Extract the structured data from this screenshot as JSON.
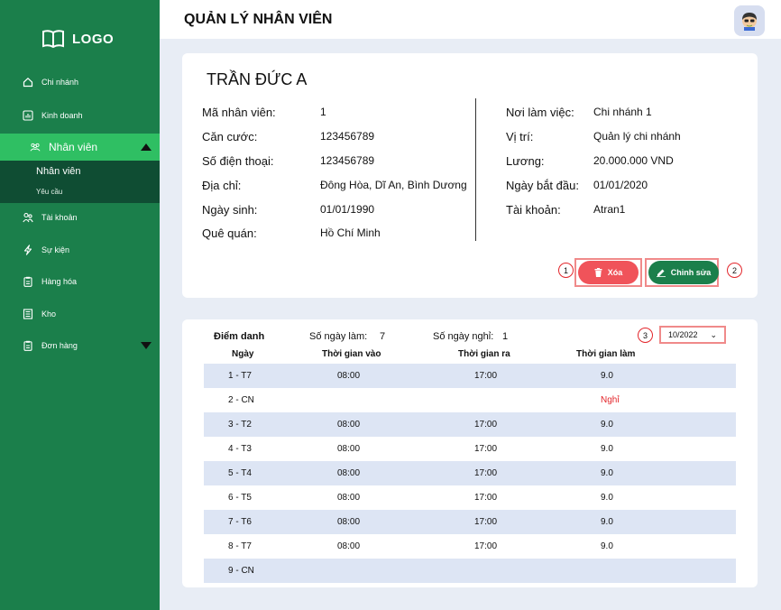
{
  "sidebar": {
    "logo": "LOGO",
    "items": [
      {
        "label": "Chi nhánh",
        "icon": "home-icon"
      },
      {
        "label": "Kinh doanh",
        "icon": "chart-icon"
      },
      {
        "label": "Nhân viên",
        "icon": "users-icon"
      },
      {
        "label": "Tài khoản",
        "icon": "account-icon"
      },
      {
        "label": "Sự kiện",
        "icon": "lightning-icon"
      },
      {
        "label": "Hàng hóa",
        "icon": "clipboard-icon"
      },
      {
        "label": "Kho",
        "icon": "warehouse-icon"
      },
      {
        "label": "Đơn hàng",
        "icon": "order-icon"
      }
    ],
    "submenu": [
      "Nhân viên",
      "Yêu cầu"
    ]
  },
  "header": {
    "title": "QUẢN LÝ NHÂN VIÊN"
  },
  "employee": {
    "name": "TRẦN ĐỨC A",
    "left_fields": [
      {
        "label": "Mã nhân viên:",
        "value": "1"
      },
      {
        "label": "Căn cước:",
        "value": "123456789"
      },
      {
        "label": "Số điện thoại:",
        "value": "123456789"
      },
      {
        "label": "Địa chỉ:",
        "value": "Đông Hòa, Dĩ An, Bình Dương"
      },
      {
        "label": "Ngày sinh:",
        "value": "01/01/1990"
      },
      {
        "label": "Quê quán:",
        "value": "Hồ Chí Minh"
      }
    ],
    "right_fields": [
      {
        "label": "Nơi làm việc:",
        "value": "Chi nhánh 1"
      },
      {
        "label": "Vị trí:",
        "value": "Quản lý chi nhánh"
      },
      {
        "label": "Lương:",
        "value": "20.000.000 VND"
      },
      {
        "label": "Ngày bắt đầu:",
        "value": "01/01/2020"
      },
      {
        "label": "Tài khoản:",
        "value": "Atran1"
      }
    ],
    "delete_label": "Xóa",
    "edit_label": "Chỉnh sửa"
  },
  "annotations": [
    "1",
    "2",
    "3"
  ],
  "attendance": {
    "title": "Điểm danh",
    "workdays_label": "Số ngày làm:",
    "workdays_value": "7",
    "offdays_label": "Số ngày nghỉ:",
    "offdays_value": "1",
    "month": "10/2022",
    "headers": [
      "Ngày",
      "Thời gian vào",
      "Thời gian ra",
      "Thời gian làm"
    ],
    "rows": [
      {
        "day": "1 - T7",
        "in": "08:00",
        "out": "17:00",
        "hours": "9.0"
      },
      {
        "day": "2 - CN",
        "in": "",
        "out": "",
        "hours": "Nghỉ"
      },
      {
        "day": "3 - T2",
        "in": "08:00",
        "out": "17:00",
        "hours": "9.0"
      },
      {
        "day": "4 - T3",
        "in": "08:00",
        "out": "17:00",
        "hours": "9.0"
      },
      {
        "day": "5 - T4",
        "in": "08:00",
        "out": "17:00",
        "hours": "9.0"
      },
      {
        "day": "6 - T5",
        "in": "08:00",
        "out": "17:00",
        "hours": "9.0"
      },
      {
        "day": "7 - T6",
        "in": "08:00",
        "out": "17:00",
        "hours": "9.0"
      },
      {
        "day": "8 - T7",
        "in": "08:00",
        "out": "17:00",
        "hours": "9.0"
      },
      {
        "day": "9 - CN",
        "in": "",
        "out": "",
        "hours": ""
      }
    ]
  },
  "colors": {
    "sidebar": "#1b7f4b",
    "active": "#2fbf63",
    "submenu": "#0f4d33",
    "delete": "#f0535a",
    "off_text": "#e3262b"
  }
}
